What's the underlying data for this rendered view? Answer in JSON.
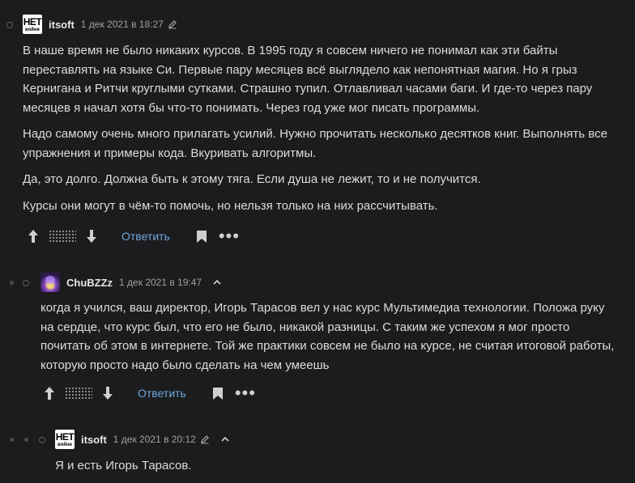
{
  "comments": [
    {
      "avatar": {
        "line1": "НЕТ",
        "line2": "войне"
      },
      "username": "itsoft",
      "time": "1 дек 2021 в 18:27",
      "paragraphs": [
        "В наше время не было никаких курсов. В 1995 году я совсем ничего не понимал как эти байты переставлять на языке Си. Первые пару месяцев всё выглядело как непонятная магия. Но я грыз Кернигана и Ритчи круглыми сутками. Страшно тупил. Отлавливал часами баги. И где-то через пару месяцев я начал хотя бы что-то понимать. Через год уже мог писать программы.",
        "Надо самому очень много прилагать усилий. Нужно прочитать несколько десятков книг. Выполнять все упражнения и примеры кода. Вкуривать алгоритмы.",
        "Да, это долго. Должна быть к этому тяга. Если душа не лежит, то и не получится.",
        "Курсы они могут в чём-то помочь, но нельзя только на них рассчитывать."
      ],
      "reply_label": "Ответить"
    },
    {
      "username": "ChuBZZz",
      "time": "1 дек 2021 в 19:47",
      "paragraphs": [
        "когда я учился, ваш директор, Игорь Тарасов вел у нас курс Мультимедиа технологии. Положа руку на сердце, что курс был, что его не было, никакой разницы. С таким же успехом я мог просто почитать об этом в интернете. Той же практики совсем не было на курсе, не считая итоговой работы, которую просто надо было сделать на чем умеешь"
      ],
      "reply_label": "Ответить"
    },
    {
      "avatar": {
        "line1": "НЕТ",
        "line2": "войне"
      },
      "username": "itsoft",
      "time": "1 дек 2021 в 20:12",
      "paragraphs": [
        "Я и есть Игорь Тарасов."
      ]
    }
  ],
  "icons": {
    "upvote": "arrow-up-icon",
    "downvote": "arrow-down-icon",
    "bookmark": "bookmark-icon",
    "more": "more-icon",
    "edit": "pencil-icon",
    "parent": "chevron-up-icon"
  },
  "colors": {
    "background": "#1c1c1e",
    "text": "#dcdcdc",
    "link": "#6fa8dc",
    "meta": "#a0a0a0"
  }
}
